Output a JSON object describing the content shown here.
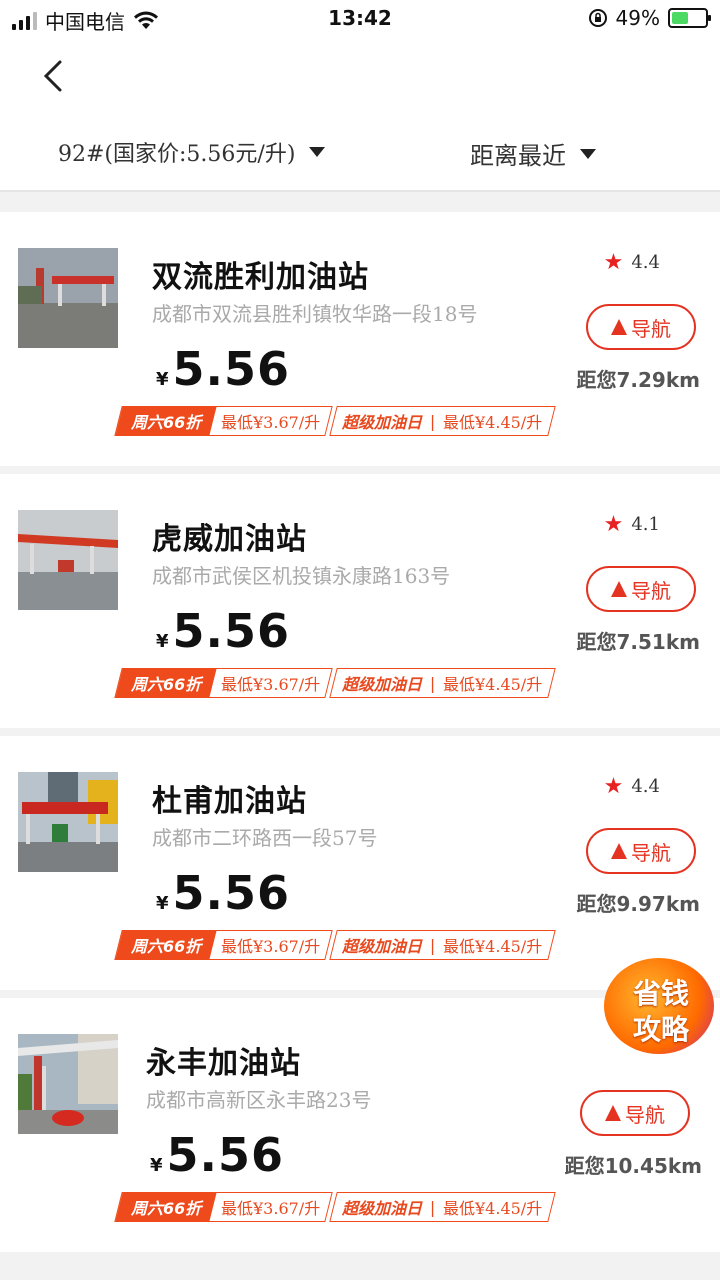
{
  "status": {
    "carrier": "中国电信",
    "time": "13:42",
    "battery": "49%",
    "battery_level": 0.49
  },
  "header": {
    "fuel_filter": "92#(国家价:5.56元/升)",
    "sort_filter": "距离最近"
  },
  "stations": [
    {
      "name": "双流胜利加油站",
      "address": "成都市双流县胜利镇牧华路一段18号",
      "currency": "¥",
      "price": "5.56",
      "rating": "4.4",
      "nav_label": "导航",
      "distance": "距您7.29km",
      "promo1_label": "周六66折",
      "promo1_value": "最低¥3.67/升",
      "promo2_label": "超级加油日",
      "promo2_sep": "|",
      "promo2_value": "最低¥4.45/升"
    },
    {
      "name": "虎威加油站",
      "address": "成都市武侯区机投镇永康路163号",
      "currency": "¥",
      "price": "5.56",
      "rating": "4.1",
      "nav_label": "导航",
      "distance": "距您7.51km",
      "promo1_label": "周六66折",
      "promo1_value": "最低¥3.67/升",
      "promo2_label": "超级加油日",
      "promo2_sep": "|",
      "promo2_value": "最低¥4.45/升"
    },
    {
      "name": "杜甫加油站",
      "address": "成都市二环路西一段57号",
      "currency": "¥",
      "price": "5.56",
      "rating": "4.4",
      "nav_label": "导航",
      "distance": "距您9.97km",
      "promo1_label": "周六66折",
      "promo1_value": "最低¥3.67/升",
      "promo2_label": "超级加油日",
      "promo2_sep": "|",
      "promo2_value": "最低¥4.45/升"
    },
    {
      "name": "永丰加油站",
      "address": "成都市高新区永丰路23号",
      "currency": "¥",
      "price": "5.56",
      "rating": "",
      "nav_label": "导航",
      "distance": "距您10.45km",
      "promo1_label": "周六66折",
      "promo1_value": "最低¥3.67/升",
      "promo2_label": "超级加油日",
      "promo2_sep": "|",
      "promo2_value": "最低¥4.45/升"
    }
  ],
  "floating": {
    "line1": "省钱",
    "line2": "攻略"
  },
  "colors": {
    "accent": "#e53322",
    "promo": "#ee4a1c",
    "star": "#e62222",
    "battery": "#4cd964"
  }
}
